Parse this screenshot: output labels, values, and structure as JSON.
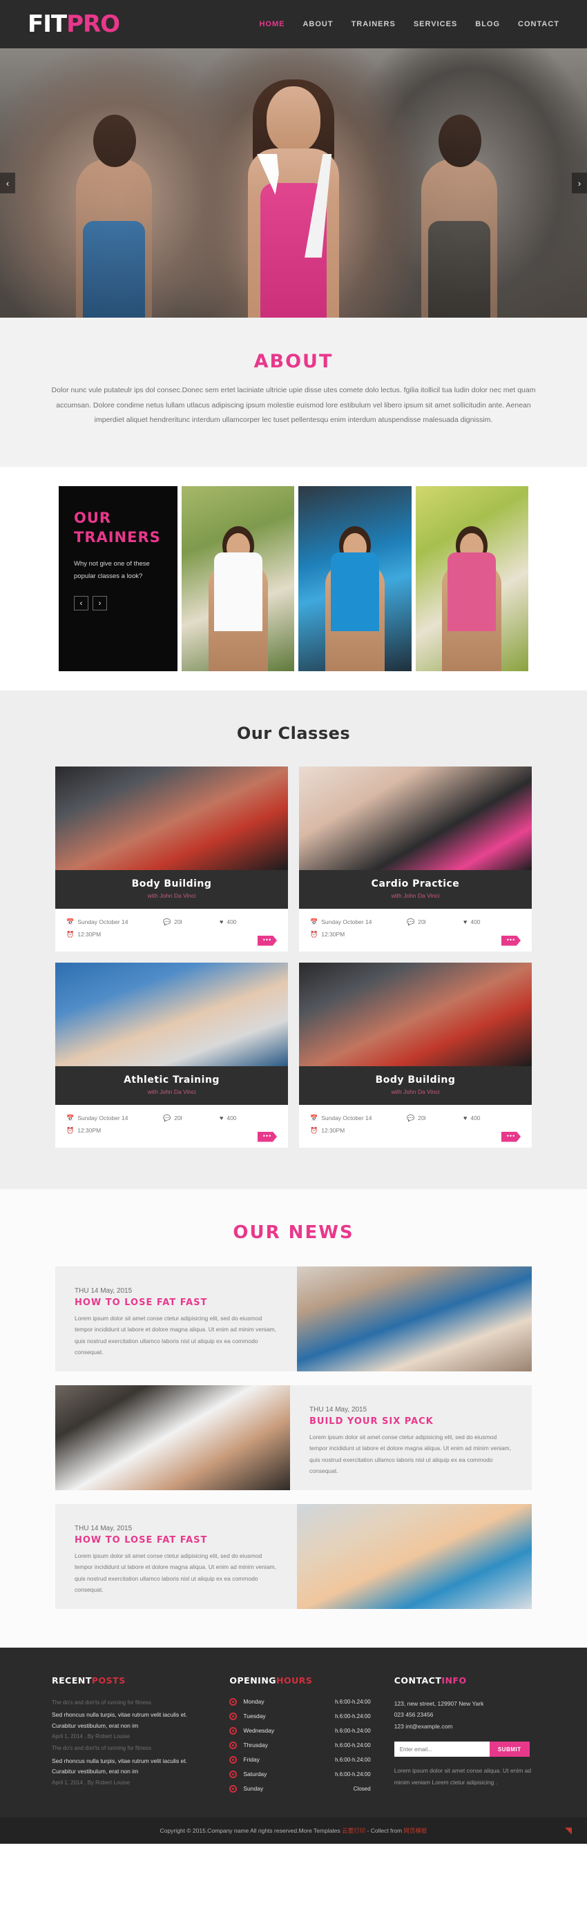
{
  "header": {
    "logo_fit": "FIT",
    "logo_pro": "PRO",
    "nav": [
      {
        "label": "HOME",
        "active": true
      },
      {
        "label": "ABOUT",
        "active": false
      },
      {
        "label": "TRAINERS",
        "active": false
      },
      {
        "label": "SERVICES",
        "active": false
      },
      {
        "label": "BLOG",
        "active": false
      },
      {
        "label": "CONTACT",
        "active": false
      }
    ]
  },
  "hero": {
    "prev": "‹",
    "next": "›"
  },
  "about": {
    "title": "ABOUT",
    "paragraph": "Dolor nunc vule putateulr ips dol consec.Donec sem ertet laciniate ultricie upie disse utes comete dolo lectus. fgilia itollicil tua ludin dolor nec met quam accumsan. Dolore condime netus lullam utlacus adipiscing ipsum molestie euismod lore estibulum vel libero ipsum sit amet sollicitudin ante. Aenean imperdiet aliquet hendreritunc interdum ullamcorper lec tuset pellentesqu enim interdum atuspendisse malesuada dignissim."
  },
  "trainers": {
    "title_line1": "OUR",
    "title_line2": "TRAINERS",
    "subtitle": "Why not give one of these popular classes a look?",
    "prev": "‹",
    "next": "›",
    "cards": [
      {
        "name": "trainer-photo-1"
      },
      {
        "name": "trainer-photo-2"
      },
      {
        "name": "trainer-photo-3"
      }
    ]
  },
  "classes": {
    "title": "Our Classes",
    "icons": {
      "calendar": "Ὄ5",
      "clock": "⏱",
      "comment": "●",
      "heart": "♥",
      "more": "•••"
    },
    "items": [
      {
        "title": "Body Building",
        "instructor": "with John Da Vinci",
        "date": "Sunday October 14",
        "time": "12:30PM",
        "comments": "20l",
        "likes": "400",
        "more": "•••"
      },
      {
        "title": "Cardio Practice",
        "instructor": "with John Da Vinci",
        "date": "Sunday October 14",
        "time": "12:30PM",
        "comments": "20l",
        "likes": "400",
        "more": "•••"
      },
      {
        "title": "Athletic Training",
        "instructor": "with John Da Vinci",
        "date": "Sunday October 14",
        "time": "12:30PM",
        "comments": "20l",
        "likes": "400",
        "more": "•••"
      },
      {
        "title": "Body Building",
        "instructor": "with John Da Vinci",
        "date": "Sunday October 14",
        "time": "12:30PM",
        "comments": "20l",
        "likes": "400",
        "more": "•••"
      }
    ]
  },
  "news": {
    "title": "OUR NEWS",
    "items": [
      {
        "date": "THU 14 May, 2015",
        "title": "HOW TO LOSE FAT FAST",
        "text": "Lorem ipsum dolor sit amet conse ctetur adipisicing elit, sed do eiusmod tempor incididunt ut labore et dolore magna aliqua. Ut enim ad minim veniam, quis nostrud exercitation ullamco laboris nisl ut aliquip ex ea commodo consequat."
      },
      {
        "date": "THU 14 May, 2015",
        "title": "BUILD YOUR SIX PACK",
        "text": "Lorem ipsum dolor sit amet conse ctetur adipisicing elit, sed do eiusmod tempor incididunt ut labore et dolore magna aliqua. Ut enim ad minim veniam, quis nostrud exercitation ullamco laboris nisl ut aliquip ex ea commodo consequat."
      },
      {
        "date": "THU 14 May, 2015",
        "title": "HOW TO LOSE FAT FAST",
        "text": "Lorem ipsum dolor sit amet conse ctetur adipisicing elit, sed do eiusmod tempor incididunt ut labore et dolore magna aliqua. Ut enim ad minim veniam, quis nostrud exercitation ullamco laboris nisl ut aliquip ex ea commodo consequat."
      }
    ]
  },
  "footer": {
    "recent_posts": {
      "title_a": "RECENT",
      "title_b": "POSTS",
      "items": [
        {
          "sub": "The do's and don'ts of running for fitness",
          "title": "Sed rhoncus nulla turpis, vitae rutrum velit iaculis et. Curabitur vestibulum, erat non im",
          "meta": "April 1, 2014 , By Robert Louise"
        },
        {
          "sub": "The do's and don'ts of running for fitness",
          "title": "Sed rhoncus nulla turpis, vitae rutrum velit iaculis et. Curabitur vestibulum, erat non im",
          "meta": "April 1, 2014 , By Robert Louise"
        }
      ]
    },
    "opening_hours": {
      "title_a": "OPENING",
      "title_b": "HOURS",
      "rows": [
        {
          "day": "Monday",
          "time": "h.6:00-h.24:00"
        },
        {
          "day": "Tuesday",
          "time": "h.6:00-h.24:00"
        },
        {
          "day": "Wednesday",
          "time": "h.6:00-h.24:00"
        },
        {
          "day": "Thrusday",
          "time": "h.6:00-h.24:00"
        },
        {
          "day": "Friday",
          "time": "h.6:00-h.24:00"
        },
        {
          "day": "Saturday",
          "time": "h.6:00-h.24:00"
        },
        {
          "day": "Sunday",
          "time": "Closed"
        }
      ]
    },
    "contact_info": {
      "title_a": "CONTACT",
      "title_b": "INFO",
      "address": "123, new street, 129907 New Yark",
      "phone": "023 456 23456",
      "email": "123 int@example.com",
      "email_placeholder": "Enter email...",
      "email_value": "",
      "submit_label": "SUBMIT",
      "note": "Lorem ipsum dolor sit amet conse aliqua. Ut enim ad minim veniam Lorem ctetur adipisicing ."
    }
  },
  "copyright": {
    "text_before": "Copyright © 2015.Company name All rights reserved.More Templates ",
    "link1": "云置打印",
    "text_mid": " - Collect from ",
    "link2": "网页模板",
    "to_top": "◥"
  },
  "colors": {
    "accent_pink": "#e8388c",
    "dark": "#2b2b2b",
    "red": "#d12f3c"
  }
}
